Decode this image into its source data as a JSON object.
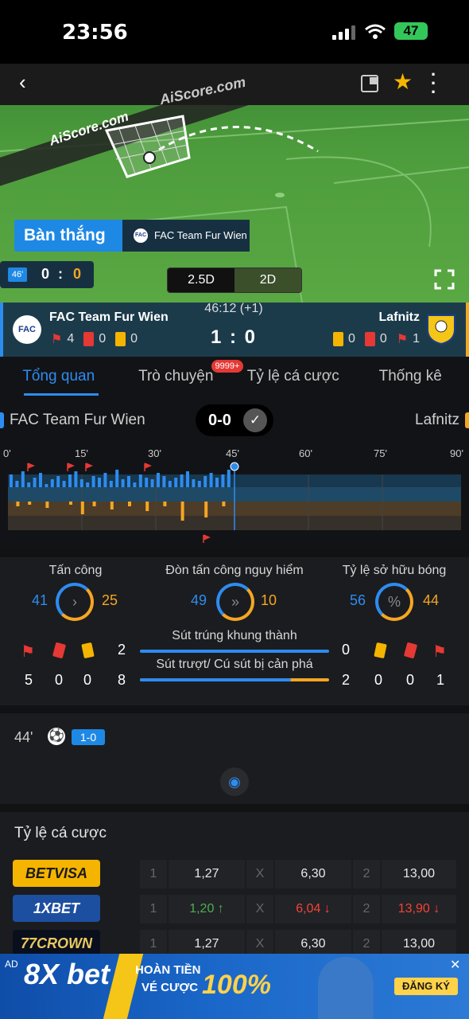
{
  "status_bar": {
    "time": "23:56",
    "battery": "47"
  },
  "pitch": {
    "watermark": "AiScore.com",
    "event_label": "Bàn thắng",
    "event_team": "FAC Team Fur Wien",
    "minute_badge": "46'",
    "mini_home": "0",
    "mini_sep": ":",
    "mini_away": "0",
    "view_25d": "2.5D",
    "view_2d": "2D"
  },
  "match": {
    "home": "FAC Team Fur Wien",
    "away": "Lafnitz",
    "home_logo": "FAC",
    "clock": "46:12 (+1)",
    "score": "1 : 0",
    "home_corners": "4",
    "home_red": "0",
    "home_yellow": "0",
    "away_yellow": "0",
    "away_red": "0",
    "away_corners": "1"
  },
  "tabs": [
    {
      "label": "Tổng quan"
    },
    {
      "label": "Trò chuyện",
      "badge": "9999+"
    },
    {
      "label": "Tỷ lệ cá cược"
    },
    {
      "label": "Thống kê"
    }
  ],
  "timeline": {
    "home": "FAC Team Fur Wien",
    "away": "Lafnitz",
    "ht_score": "0-0",
    "ticks": [
      "0'",
      "15'",
      "30'",
      "45'",
      "60'",
      "75'",
      "90'"
    ]
  },
  "stats": {
    "attack": {
      "label": "Tấn công",
      "home": "41",
      "away": "25"
    },
    "dangerous": {
      "label": "Đòn tấn công nguy hiểm",
      "home": "49",
      "away": "10"
    },
    "possession": {
      "label": "Tỷ lệ sở hữu bóng",
      "home": "56",
      "away": "44",
      "icon": "%"
    },
    "on_target": {
      "label": "Sút trúng khung thành",
      "home": "2",
      "away": "0"
    },
    "off_target": {
      "label": "Sút trượt/ Cú sút bị cản phá",
      "home": "8",
      "away": "2"
    },
    "home_corners": "5",
    "home_red": "0",
    "home_yellow": "0",
    "away_yellow": "0",
    "away_red": "0",
    "away_corners": "1"
  },
  "events": [
    {
      "minute": "44'",
      "score": "1-0"
    }
  ],
  "odds": {
    "title": "Tỷ lệ cá cược",
    "rows": [
      {
        "brand": "BETVISA",
        "k1": "1",
        "v1": "1,27",
        "kx": "X",
        "vx": "6,30",
        "k2": "2",
        "v2": "13,00"
      },
      {
        "brand": "1XBET",
        "k1": "1",
        "v1": "1,20",
        "kx": "X",
        "vx": "6,04",
        "k2": "2",
        "v2": "13,90"
      },
      {
        "brand": "77CROWN",
        "k1": "1",
        "v1": "1,27",
        "kx": "X",
        "vx": "6,30",
        "k2": "2",
        "v2": "13,00"
      }
    ]
  },
  "ad": {
    "tag": "AD",
    "brand": "8X bet",
    "line1": "HOÀN TIỀN",
    "line2": "VÉ CƯỢC",
    "percent": "100%",
    "cta": "ĐĂNG KÝ"
  },
  "colors": {
    "home": "#2d8cf0",
    "away": "#f5a623",
    "up": "#4caf50",
    "down": "#f44336"
  }
}
